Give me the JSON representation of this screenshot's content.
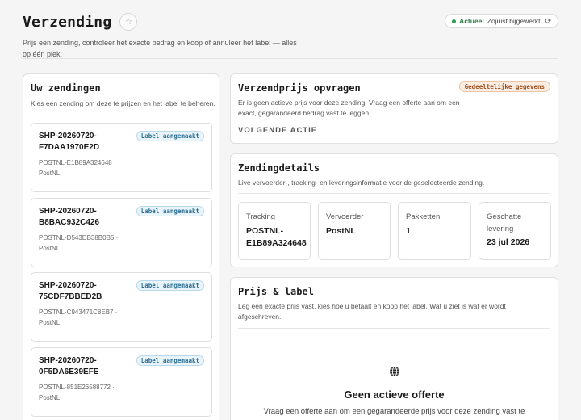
{
  "header": {
    "title": "Verzending",
    "subtitle": "Prijs een zending, controleer het exacte bedrag en koop of annuleer het label — alles op één plek.",
    "favorite_icon": "star-icon",
    "status": {
      "state": "Actueel",
      "updated": "Zojuist bijgewerkt",
      "refresh_icon": "refresh-icon"
    }
  },
  "shipments": {
    "title": "Uw zendingen",
    "subtitle": "Kies een zending om deze te prijzen en het label te beheren.",
    "items": [
      {
        "id": "SHP-20260720-F7DAA1970E2D",
        "status": "Label aangemaakt",
        "tracking": "POSTNL-E1B89A324648 ·",
        "carrier": "PostNL"
      },
      {
        "id": "SHP-20260720-B8BAC932C426",
        "status": "Label aangemaakt",
        "tracking": "POSTNL-D543DB38B0B5 ·",
        "carrier": "PostNL"
      },
      {
        "id": "SHP-20260720-75CDF7BBED2B",
        "status": "Label aangemaakt",
        "tracking": "POSTNL-C943471C8EB7 ·",
        "carrier": "PostNL"
      },
      {
        "id": "SHP-20260720-0F5DA6E39EFE",
        "status": "Label aangemaakt",
        "tracking": "POSTNL-851E26588772 ·",
        "carrier": "PostNL"
      }
    ]
  },
  "quote": {
    "title": "Verzendprijs opvragen",
    "badge": "Gedeeltelijke gegevens",
    "text": "Er is geen actieve prijs voor deze zending. Vraag een offerte aan om een exact, gegarandeerd bedrag vast te leggen.",
    "next_action": "VOLGENDE ACTIE"
  },
  "details": {
    "title": "Zendingdetails",
    "subtitle": "Live vervoerder-, tracking- en leveringsinformatie voor de geselecteerde zending.",
    "tracking_label": "Tracking",
    "tracking_value": "POSTNL-E1B89A324648",
    "carrier_label": "Vervoerder",
    "carrier_value": "PostNL",
    "packages_label": "Pakketten",
    "packages_value": "1",
    "delivery_label": "Geschatte levering",
    "delivery_value": "23 jul 2026"
  },
  "price": {
    "title": "Prijs & label",
    "subtitle": "Leg een exacte prijs vast, kies hoe u betaalt en koop het label. Wat u ziet is wat er wordt afgeschreven.",
    "empty_icon": "globe-icon",
    "empty_title": "Geen actieve offerte",
    "empty_text": "Vraag een offerte aan om een gegarandeerde prijs voor deze zending vast te"
  },
  "colors": {
    "status_green": "#2e9e4f",
    "label_badge": "#e9f4fa",
    "warning_badge": "#fbede2"
  }
}
